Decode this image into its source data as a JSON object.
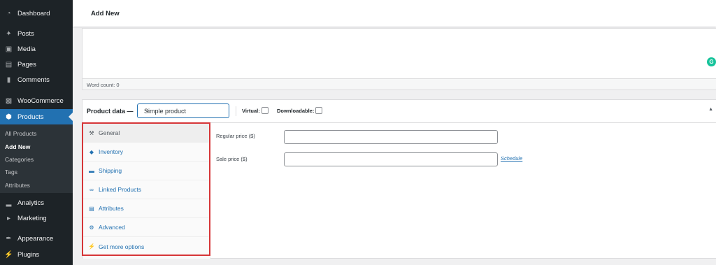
{
  "sidebar": {
    "menu": [
      {
        "label": "Dashboard",
        "icon": "dashboard-icon"
      },
      {
        "label": "Posts",
        "icon": "pin-icon"
      },
      {
        "label": "Media",
        "icon": "media-icon"
      },
      {
        "label": "Pages",
        "icon": "pages-icon"
      },
      {
        "label": "Comments",
        "icon": "comment-icon"
      },
      {
        "label": "WooCommerce",
        "icon": "woo-icon"
      },
      {
        "label": "Products",
        "icon": "products-icon"
      },
      {
        "label": "Analytics",
        "icon": "analytics-icon"
      },
      {
        "label": "Marketing",
        "icon": "megaphone-icon"
      },
      {
        "label": "Appearance",
        "icon": "brush-icon"
      },
      {
        "label": "Plugins",
        "icon": "plug-icon"
      }
    ],
    "submenu": [
      "All Products",
      "Add New",
      "Categories",
      "Tags",
      "Attributes"
    ]
  },
  "header": {
    "title": "Add New"
  },
  "editor": {
    "word_count": "Word count: 0",
    "grammarly_letter": "G"
  },
  "product_data": {
    "label": "Product data —",
    "type_select": "Simple product",
    "virtual_label": "Virtual:",
    "downloadable_label": "Downloadable:",
    "tabs": [
      {
        "label": "General",
        "icon": "wrench-icon"
      },
      {
        "label": "Inventory",
        "icon": "tag-icon"
      },
      {
        "label": "Shipping",
        "icon": "truck-icon"
      },
      {
        "label": "Linked Products",
        "icon": "link-icon"
      },
      {
        "label": "Attributes",
        "icon": "table-icon"
      },
      {
        "label": "Advanced",
        "icon": "gear-icon"
      },
      {
        "label": "Get more options",
        "icon": "plug-icon"
      }
    ],
    "regular_price_label": "Regular price ($)",
    "sale_price_label": "Sale price ($)",
    "schedule_link": "Schedule"
  },
  "colors": {
    "accent": "#2271b1",
    "sidebar_bg": "#1d2327",
    "highlight": "#d63638"
  }
}
